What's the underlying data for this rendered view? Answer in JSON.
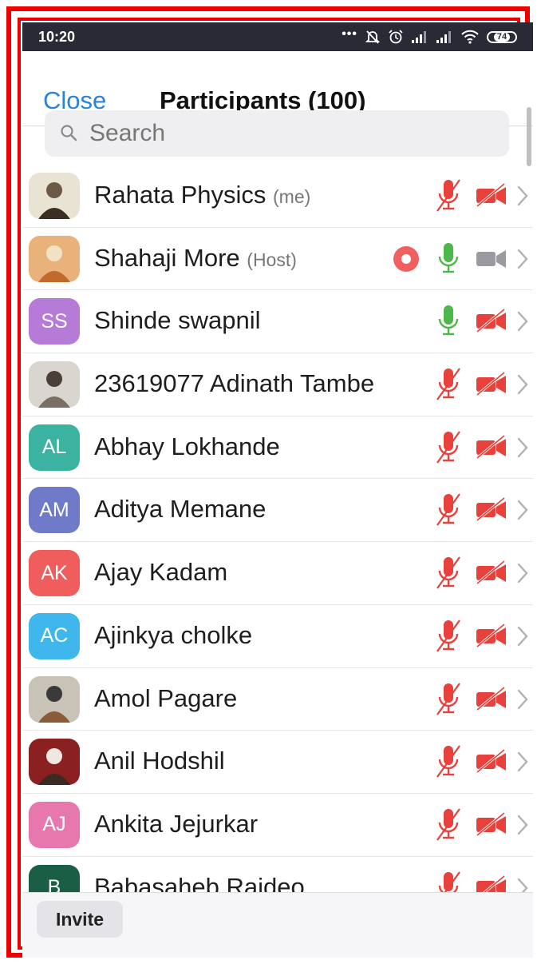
{
  "status_bar": {
    "time": "10:20",
    "battery": "74",
    "icons": [
      "more-dots-icon",
      "bell-muted-icon",
      "alarm-icon",
      "signal-icon",
      "signal-icon",
      "wifi-icon",
      "battery-icon"
    ]
  },
  "header": {
    "close_label": "Close",
    "title": "Participants (100)"
  },
  "search": {
    "placeholder": "Search"
  },
  "participants": [
    {
      "name": "Rahata Physics",
      "tag": "(me)",
      "avatar": "photo",
      "mic": "muted",
      "video": "off",
      "recording": false
    },
    {
      "name": "Shahaji More",
      "tag": "(Host)",
      "avatar": "photo",
      "mic": "on",
      "video": "available",
      "recording": true
    },
    {
      "name": "Shinde swapnil",
      "tag": "",
      "avatar": "SS",
      "avatar_color": "#b57bd6",
      "mic": "on",
      "video": "off",
      "recording": false
    },
    {
      "name": "23619077 Adinath Tambe",
      "tag": "",
      "avatar": "photo",
      "mic": "muted",
      "video": "off",
      "recording": false
    },
    {
      "name": "Abhay Lokhande",
      "tag": "",
      "avatar": "AL",
      "avatar_color": "#3bb3a0",
      "mic": "muted",
      "video": "off",
      "recording": false
    },
    {
      "name": "Aditya Memane",
      "tag": "",
      "avatar": "AM",
      "avatar_color": "#6f7bc8",
      "mic": "muted",
      "video": "off",
      "recording": false
    },
    {
      "name": "Ajay Kadam",
      "tag": "",
      "avatar": "AK",
      "avatar_color": "#f05d5d",
      "mic": "muted",
      "video": "off",
      "recording": false
    },
    {
      "name": "Ajinkya cholke",
      "tag": "",
      "avatar": "AC",
      "avatar_color": "#3fb6ec",
      "mic": "muted",
      "video": "off",
      "recording": false
    },
    {
      "name": "Amol Pagare",
      "tag": "",
      "avatar": "photo",
      "mic": "muted",
      "video": "off",
      "recording": false
    },
    {
      "name": "Anil Hodshil",
      "tag": "",
      "avatar": "photo",
      "mic": "muted",
      "video": "off",
      "recording": false
    },
    {
      "name": "Ankita Jejurkar",
      "tag": "",
      "avatar": "AJ",
      "avatar_color": "#e678ae",
      "mic": "muted",
      "video": "off",
      "recording": false
    },
    {
      "name": "Babasaheb Raideo",
      "tag": "",
      "avatar": "B",
      "avatar_color": "#1a5e45",
      "mic": "muted",
      "video": "off",
      "recording": false
    }
  ],
  "footer": {
    "invite_label": "Invite"
  },
  "colors": {
    "accent": "#2c82d8",
    "muted_red": "#e8413c",
    "mic_green": "#4cb84a",
    "frame_red": "#ee0000",
    "status_bar_bg": "#2a2a36"
  }
}
